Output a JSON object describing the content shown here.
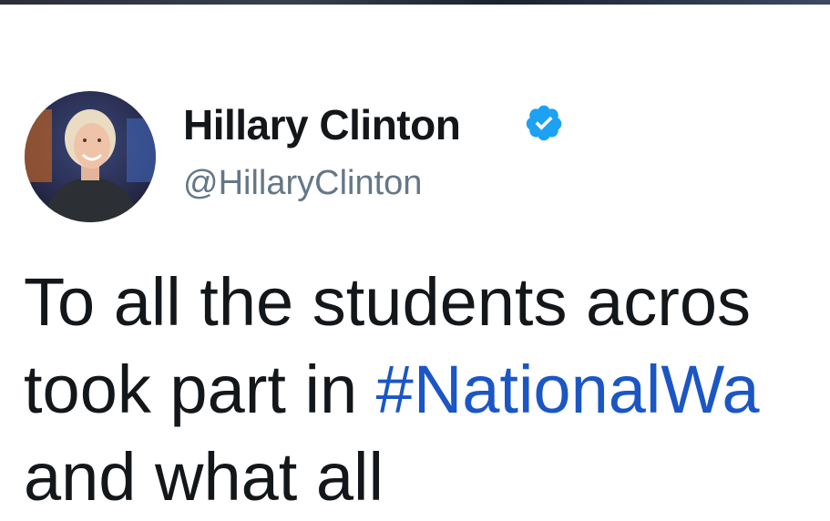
{
  "header": {
    "display_name": "Hillary Clinton",
    "handle": "@HillaryClinton",
    "verified": true
  },
  "avatar": {
    "icon": "profile-photo-icon"
  },
  "tweet": {
    "line1": "To all the students acros",
    "line2_prefix": "took part in ",
    "line2_hashtag": "#NationalWa",
    "line3": "and what all",
    "hashtag_color": "#1b56c5"
  },
  "colors": {
    "name": "#14171a",
    "handle": "#657786",
    "verified_badge": "#1da1f2"
  }
}
